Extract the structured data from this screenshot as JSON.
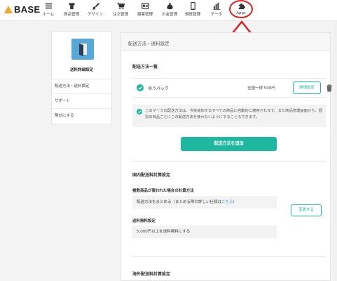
{
  "brand": {
    "name": "BASE",
    "accent": "#1eb8a0",
    "logo_color": "#f5a623"
  },
  "nav": [
    {
      "label": "ホーム",
      "icon": "menu-lines-icon"
    },
    {
      "label": "商品管理",
      "icon": "tshirt-icon"
    },
    {
      "label": "デザイン",
      "icon": "brush-icon"
    },
    {
      "label": "注文管理",
      "icon": "cart-icon"
    },
    {
      "label": "顧客管理",
      "icon": "id-card-icon"
    },
    {
      "label": "お金管理",
      "icon": "money-bag-icon"
    },
    {
      "label": "規役管理",
      "icon": "phone-icon"
    },
    {
      "label": "データ",
      "icon": "bar-chart-icon"
    },
    {
      "label": "Apps",
      "icon": "puzzle-icon"
    }
  ],
  "annotation": {
    "color": "#e0201b"
  },
  "sidebar": {
    "title": "送料詳細設定",
    "icon": "shipping-app-icon",
    "items": [
      {
        "label": "配送方法・送料設定"
      },
      {
        "label": "サポート"
      },
      {
        "label": "無効にする"
      }
    ]
  },
  "main": {
    "header": "配送方法・送料設定",
    "list_title": "配送方法一覧",
    "method": {
      "name": "ゆうパック",
      "price": "全国一律 500円",
      "detail_button": "詳細設定"
    },
    "notice": "このマークの配送方法は、今後追加するすべての商品に自動的に適用されます。また商品管理画面から、個別の商品ごとにこの配送方法を使わないようにすることもできます。",
    "add_button": "配送方法を追加",
    "domestic_title": "国内配送料計算設定",
    "multi_label": "複数商品が買われた場合の計算方法",
    "multi_value_pre": "配送方法をまとめる（まとめる際の詳しい仕様は",
    "multi_link": "こちら",
    "multi_value_post": "）",
    "change_button": "変更する",
    "free_label": "送料無料設定",
    "free_value": "5,000円以上を送料無料にする",
    "intl_title": "海外配送料計算設定"
  }
}
